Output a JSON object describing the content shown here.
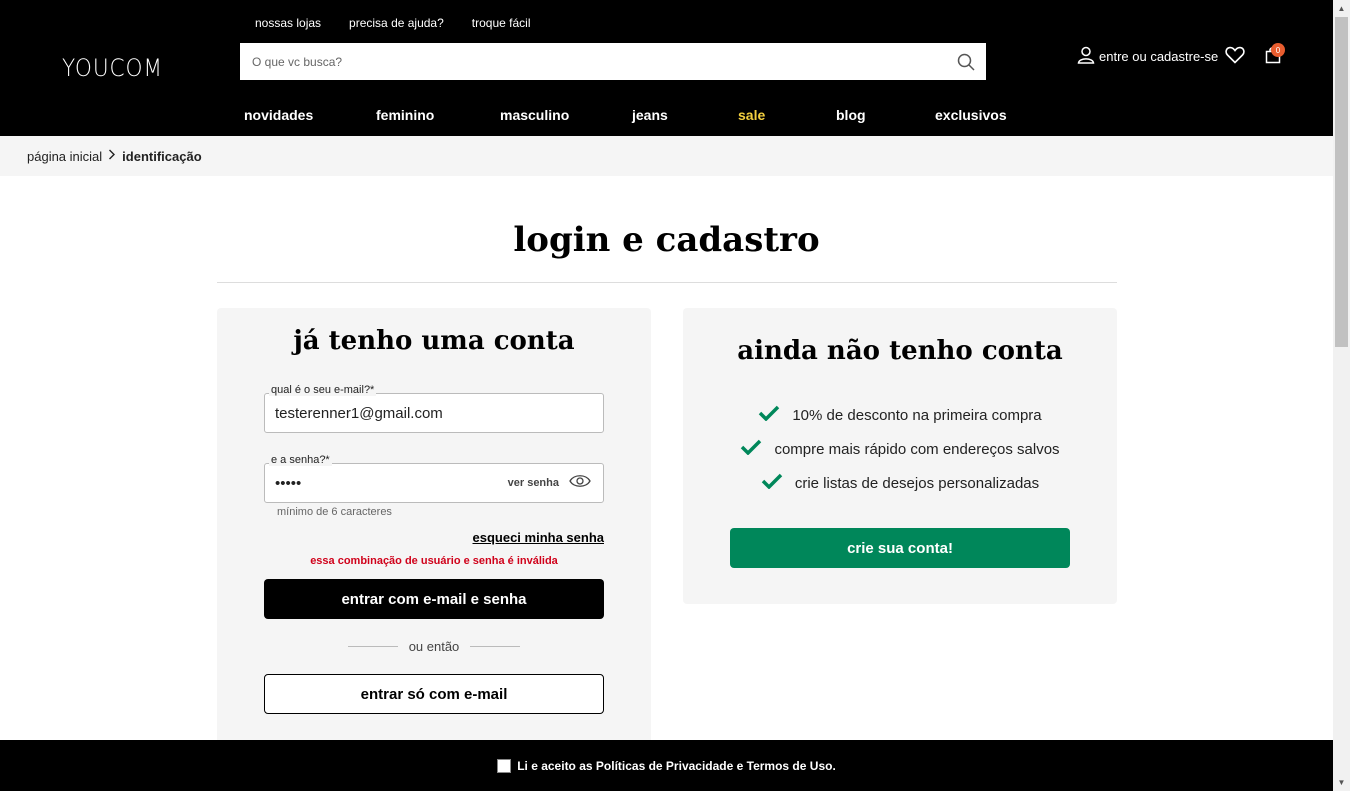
{
  "header": {
    "logo": "YOUCOM",
    "top_links": [
      "nossas lojas",
      "precisa de ajuda?",
      "troque fácil"
    ],
    "search_placeholder": "O que vc busca?",
    "account_label": "entre ou cadastre-se",
    "cart_count": "0",
    "nav": [
      "novidades",
      "feminino",
      "masculino",
      "jeans",
      "sale",
      "blog",
      "exclusivos"
    ]
  },
  "breadcrumb": {
    "home": "página inicial",
    "current": "identificação"
  },
  "page_title": "login e cadastro",
  "login": {
    "title": "já tenho uma conta",
    "email_label": "qual é o seu e-mail?*",
    "email_value": "testerenner1@gmail.com",
    "password_label": "e a senha?*",
    "password_value": "•••••",
    "show_password": "ver senha",
    "hint": "mínimo de 6 caracteres",
    "forgot": "esqueci minha senha",
    "error": "essa combinação de usuário e senha é inválida",
    "submit": "entrar com e-mail e senha",
    "or": "ou então",
    "email_only": "entrar só com e-mail"
  },
  "signup": {
    "title": "ainda não tenho conta",
    "benefits": [
      "10% de desconto na primeira compra",
      "compre mais rápido com endereços salvos",
      "crie listas de desejos personalizadas"
    ],
    "create": "crie sua conta!"
  },
  "cookie": {
    "text": "Li e aceito as Políticas de Privacidade e Termos de Uso."
  },
  "colors": {
    "accent_green": "#00875a",
    "sale_yellow": "#f4d03f",
    "error_red": "#d0021b",
    "badge_orange": "#e85d2f"
  }
}
